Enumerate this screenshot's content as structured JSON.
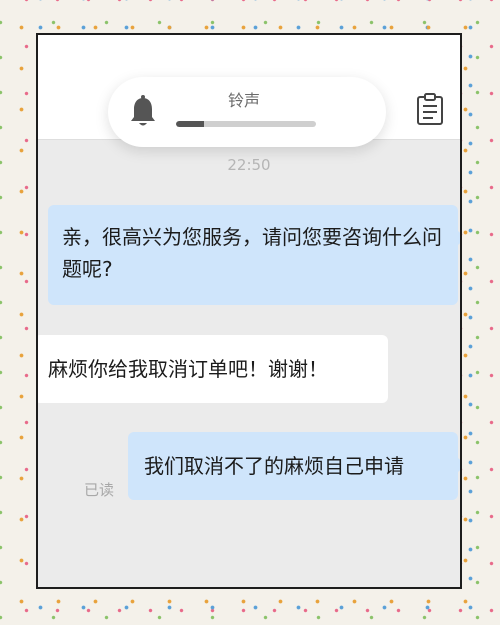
{
  "header": {
    "ringtone_label": "铃声",
    "volume_level": 0.2,
    "bell_icon": "bell-icon",
    "clipboard_icon": "clipboard-icon"
  },
  "chat": {
    "timestamp": "22:50",
    "messages": [
      {
        "side": "outgoing",
        "text": "亲，很高兴为您服务，请问您要咨询什么问题呢?"
      },
      {
        "side": "incoming",
        "text": "麻烦你给我取消订单吧！谢谢！"
      },
      {
        "side": "outgoing",
        "text": "我们取消不了的麻烦自己申请"
      }
    ],
    "read_status": "已读"
  },
  "colors": {
    "outgoing_bubble": "#cfe5fb",
    "incoming_bubble": "#ffffff",
    "chat_background": "#ebebeb"
  }
}
